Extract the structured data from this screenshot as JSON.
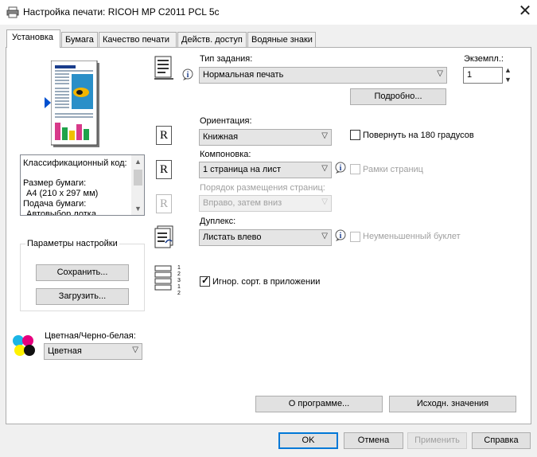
{
  "window": {
    "title": "Настройка печати: RICOH MP C2011 PCL 5c",
    "close_glyph": "✕"
  },
  "tabs": [
    "Установка",
    "Бумага",
    "Качество печати",
    "Действ. доступ",
    "Водяные знаки"
  ],
  "left": {
    "info_box": {
      "header": "Классификационный код:",
      "lines": [
        "Размер бумаги:",
        "А4 (210 x 297 мм)",
        "Подача бумаги:",
        "Автовыбор лотка"
      ]
    },
    "settings_group": {
      "title": "Параметры настройки",
      "save": "Сохранить...",
      "load": "Загрузить..."
    },
    "color": {
      "label": "Цветная/Черно-белая:",
      "value": "Цветная"
    }
  },
  "job": {
    "type_label": "Тип задания:",
    "type_value": "Нормальная печать",
    "copies_label": "Экземпл.:",
    "copies_value": "1",
    "details_button": "Подробно..."
  },
  "orientation": {
    "label": "Ориентация:",
    "value": "Книжная",
    "rotate_label": "Повернуть на 180 градусов",
    "rotate_checked": false
  },
  "layout": {
    "label": "Компоновка:",
    "value": "1 страница на лист",
    "frames_label": "Рамки страниц",
    "frames_checked": false
  },
  "page_order": {
    "label": "Порядок размещения страниц:",
    "value": "Вправо, затем вниз"
  },
  "duplex": {
    "label": "Дуплекс:",
    "value": "Листать влево",
    "booklet_label": "Неуменьшенный буклет",
    "booklet_checked": false
  },
  "collate": {
    "label": "Игнор. сорт. в приложении",
    "checked": true
  },
  "icons": {
    "r_glyph": "R",
    "copies_digits": [
      "1",
      "2",
      "3"
    ]
  },
  "bottom": {
    "about": "О программе...",
    "defaults": "Исходн. значения"
  },
  "footer": {
    "ok": "OK",
    "cancel": "Отмена",
    "apply": "Применить",
    "help": "Справка"
  }
}
